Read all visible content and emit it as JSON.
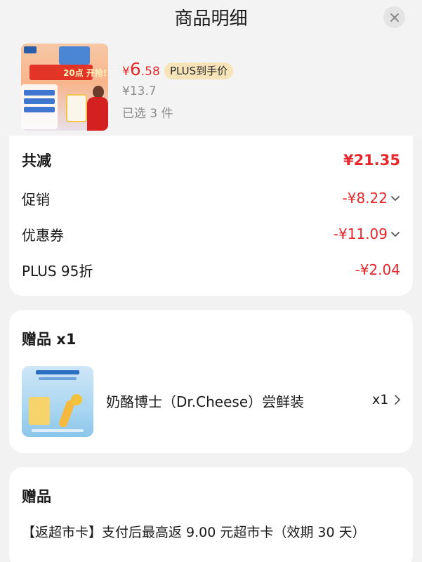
{
  "header": {
    "title": "商品明细",
    "close_icon": "close-icon"
  },
  "product": {
    "image_alt": "商品图片",
    "image_texts": {
      "banner": "20点 开抢!"
    },
    "price_symbol": "¥",
    "price_int": "6",
    "price_decimal": ".58",
    "plus_tag": "PLUS到手价",
    "original_price": "¥13.7",
    "selected_count": "已选 3 件"
  },
  "discount": {
    "total_label": "共减",
    "total_value": "¥21.35",
    "items": [
      {
        "label": "促销",
        "value": "-¥8.22",
        "has_chevron": true
      },
      {
        "label": "优惠券",
        "value": "-¥11.09",
        "has_chevron": true
      },
      {
        "label": "PLUS 95折",
        "value": "-¥2.04",
        "has_chevron": false
      }
    ]
  },
  "gift": {
    "title": "赠品 x1",
    "item_name": "奶酪博士（Dr.Cheese）尝鲜装",
    "item_qty": "x1"
  },
  "gift2": {
    "title": "赠品",
    "description": "【返超市卡】支付后最高返 9.00 元超市卡（效期 30 天）"
  },
  "colors": {
    "accent_red": "#e4282b",
    "plus_bg": "#f6e3b8",
    "muted_text": "#8c8c8c",
    "page_bg": "#f2f2f2"
  }
}
